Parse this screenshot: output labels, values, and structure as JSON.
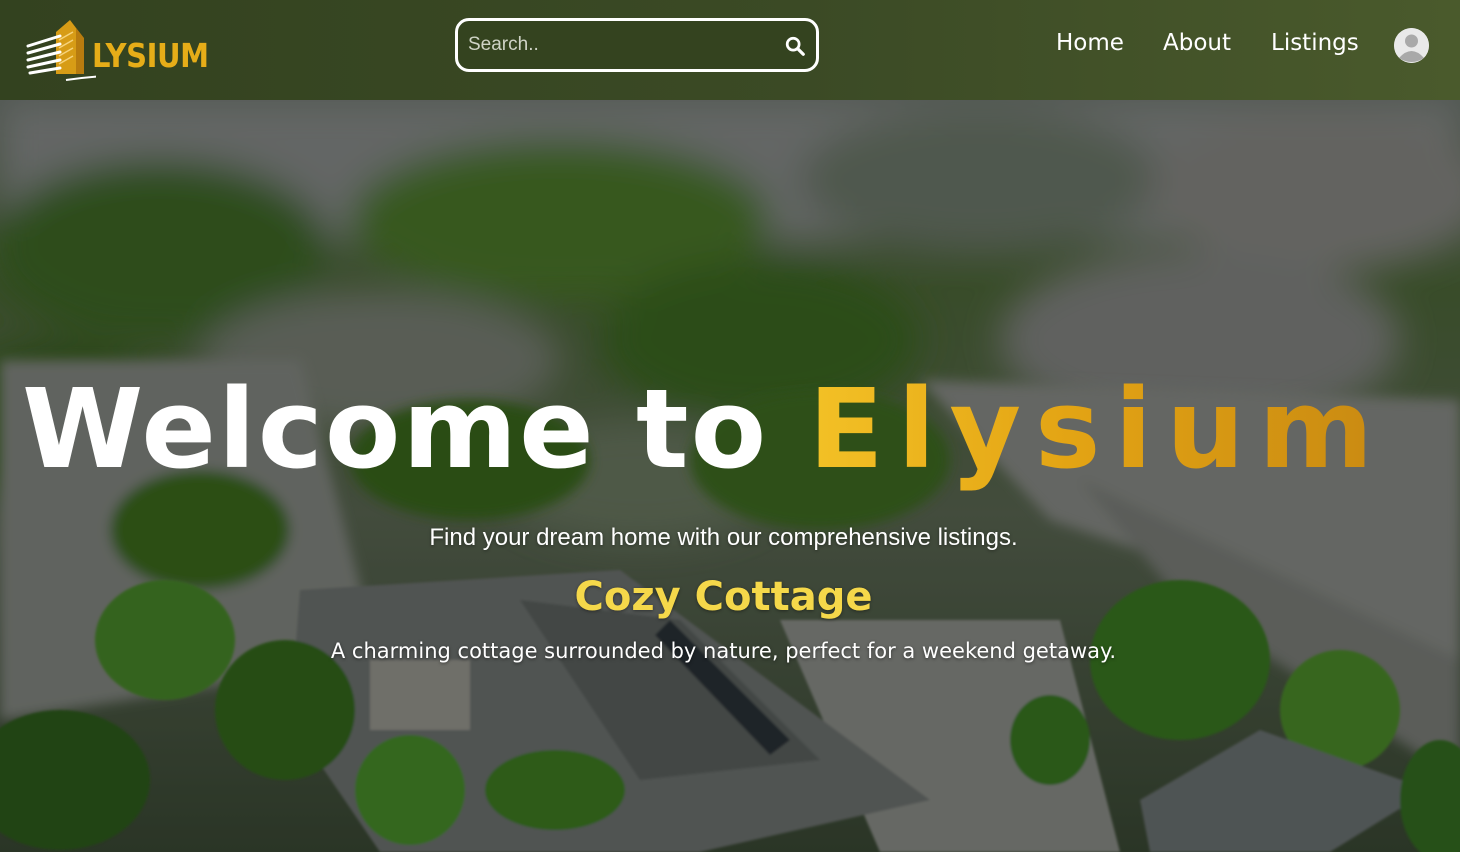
{
  "brand": {
    "logo_text": "LYSIUM",
    "logo_color": "#e6ad18"
  },
  "search": {
    "placeholder": "Search.."
  },
  "nav": {
    "links": [
      {
        "label": "Home"
      },
      {
        "label": "About"
      },
      {
        "label": "Listings"
      }
    ]
  },
  "hero": {
    "title_prefix": "Welcome to",
    "title_brand": "Elysium",
    "subtitle": "Find your dream home with our comprehensive listings.",
    "featured": {
      "name": "Cozy Cottage",
      "description": "A charming cottage surrounded by nature, perfect for a weekend getaway."
    }
  },
  "colors": {
    "nav_bg": "#3b4a25",
    "brand_gold": "#e3a414",
    "featured_yellow": "#f5d84a"
  },
  "icons": {
    "search": "search-icon",
    "avatar": "user-avatar-icon",
    "logo": "building-logo-icon"
  }
}
